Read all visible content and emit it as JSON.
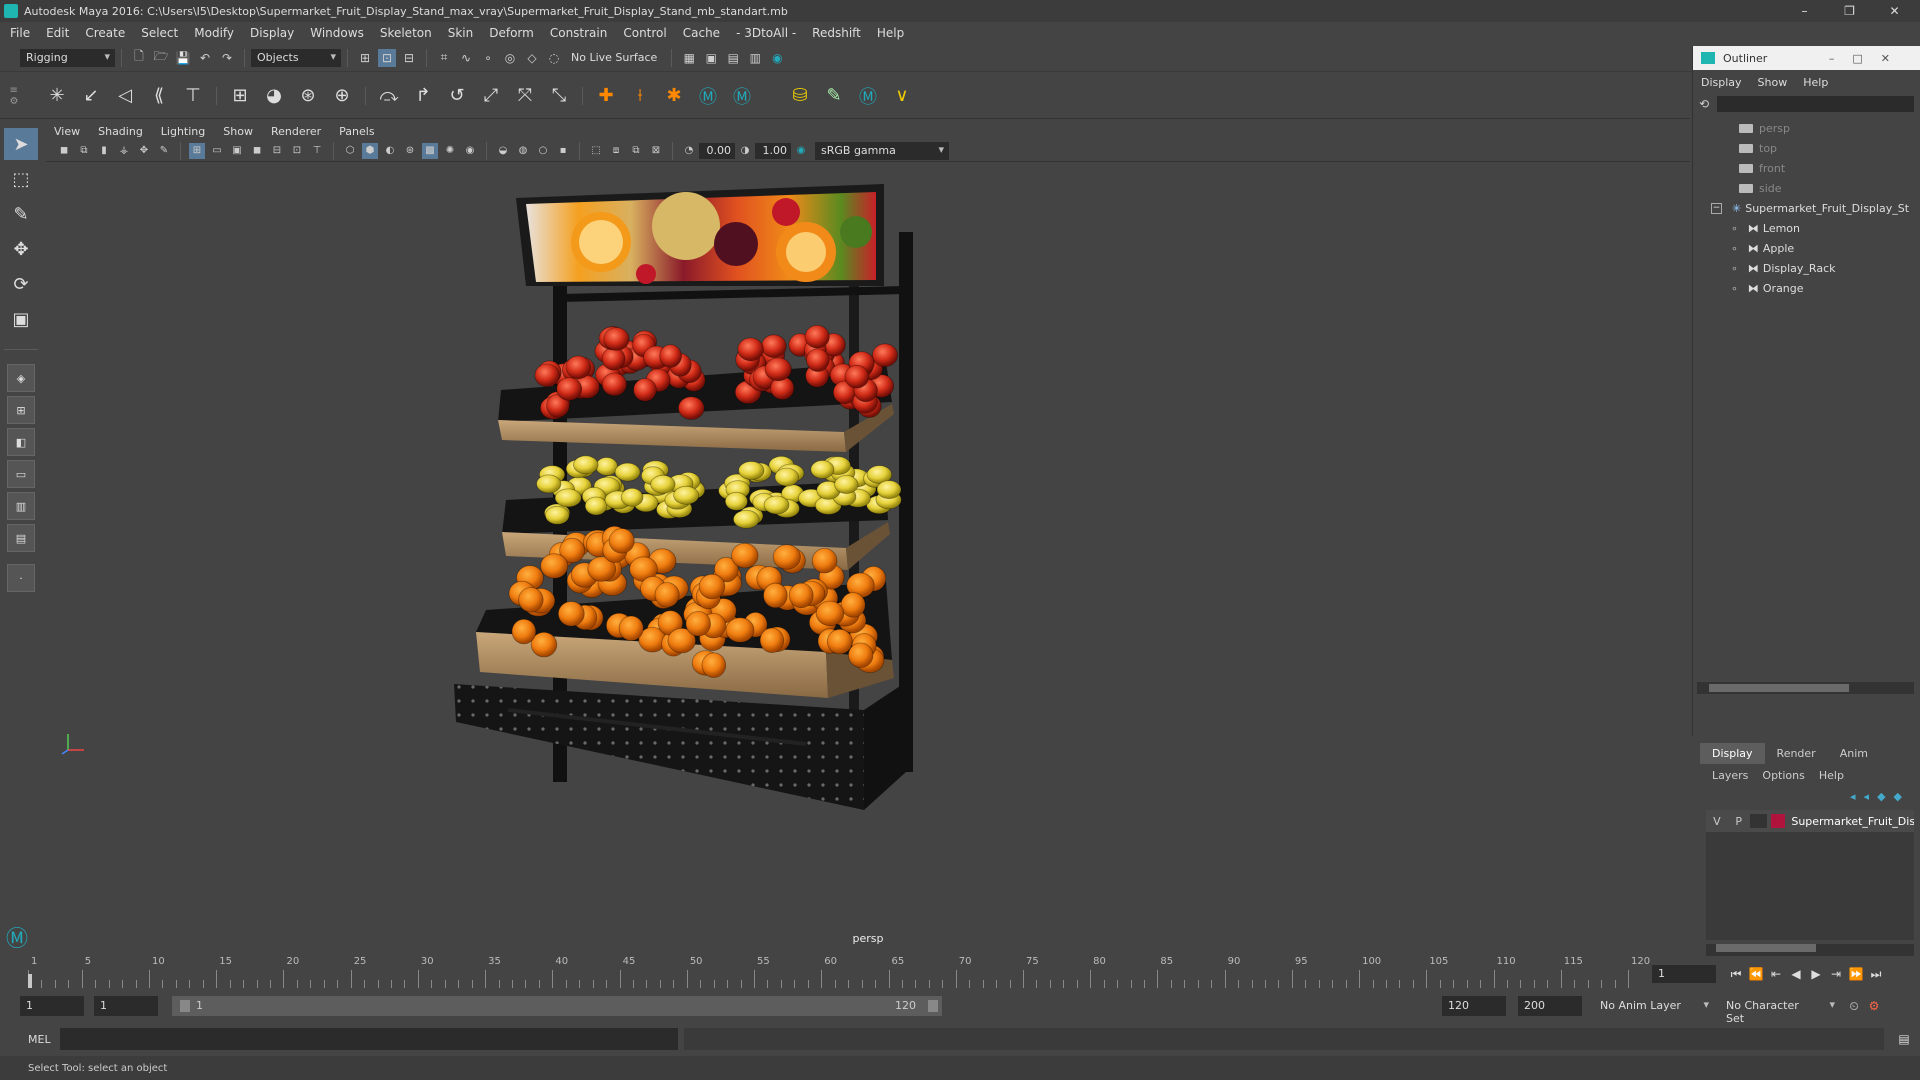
{
  "window": {
    "title": "Autodesk Maya 2016: C:\\Users\\I5\\Desktop\\Supermarket_Fruit_Display_Stand_max_vray\\Supermarket_Fruit_Display_Stand_mb_standart.mb",
    "minimize": "–",
    "maximize": "❐",
    "close": "✕"
  },
  "menu": [
    "File",
    "Edit",
    "Create",
    "Select",
    "Modify",
    "Display",
    "Windows",
    "Skeleton",
    "Skin",
    "Deform",
    "Constrain",
    "Control",
    "Cache",
    "- 3DtoAll -",
    "Redshift",
    "Help"
  ],
  "status": {
    "mode": "Rigging",
    "selection_mask": "Objects",
    "live_surface": "No Live Surface"
  },
  "panel": {
    "menu": [
      "View",
      "Shading",
      "Lighting",
      "Show",
      "Renderer",
      "Panels"
    ],
    "exposure": "0.00",
    "gamma": "1.00",
    "color_space": "sRGB gamma",
    "camera": "persp"
  },
  "outliner": {
    "title": "Outliner",
    "menu": [
      "Display",
      "Show",
      "Help"
    ],
    "cameras": [
      "persp",
      "top",
      "front",
      "side"
    ],
    "group": "Supermarket_Fruit_Display_St",
    "children": [
      "Lemon",
      "Apple",
      "Display_Rack",
      "Orange"
    ]
  },
  "layers": {
    "tabs": [
      "Display",
      "Render",
      "Anim"
    ],
    "menu": [
      "Layers",
      "Options",
      "Help"
    ],
    "layer": {
      "v": "V",
      "p": "P",
      "name": "Supermarket_Fruit_Dis",
      "color": "#b0143c"
    }
  },
  "timeline": {
    "ticks": [
      "1",
      "5",
      "10",
      "15",
      "20",
      "25",
      "30",
      "35",
      "40",
      "45",
      "50",
      "55",
      "60",
      "65",
      "70",
      "75",
      "80",
      "85",
      "90",
      "95",
      "100",
      "105",
      "110",
      "115",
      "120"
    ],
    "current_frame": "1"
  },
  "range": {
    "start": "1",
    "playback_start": "1",
    "slider_start": "1",
    "slider_end": "120",
    "playback_end": "120",
    "end": "200",
    "anim_layer": "No Anim Layer",
    "char_set": "No Character Set"
  },
  "cmd": {
    "label": "MEL"
  },
  "help": "Select Tool: select an object"
}
